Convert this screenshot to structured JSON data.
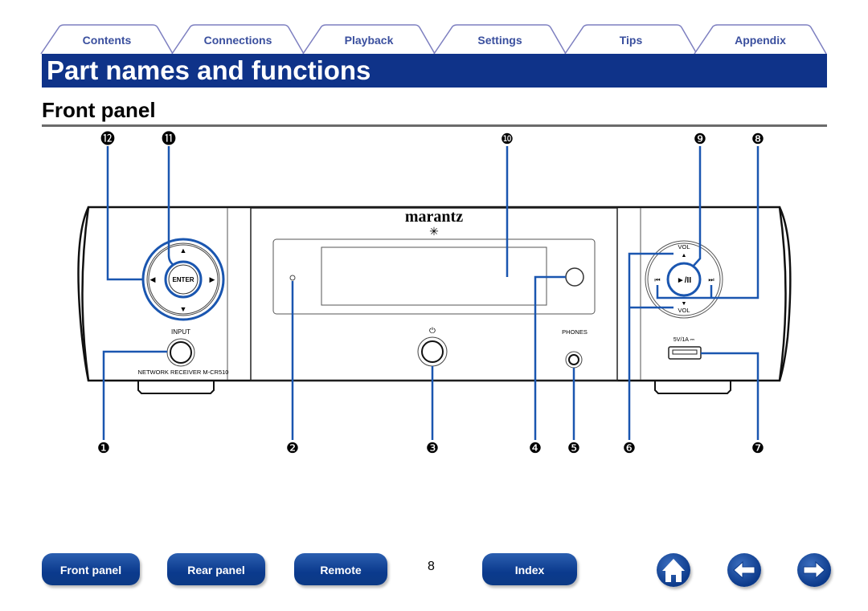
{
  "tabs": [
    {
      "label": "Contents"
    },
    {
      "label": "Connections"
    },
    {
      "label": "Playback"
    },
    {
      "label": "Settings"
    },
    {
      "label": "Tips"
    },
    {
      "label": "Appendix"
    }
  ],
  "page_title": "Part names and functions",
  "section_title": "Front panel",
  "device": {
    "brand_logo": "marantz",
    "enter_label": "ENTER",
    "input_label": "INPUT",
    "model_label": "NETWORK RECEIVER M-CR510",
    "phones_label": "PHONES",
    "vol_up_label": "VOL",
    "vol_down_label": "VOL",
    "play_pause_label": "►/II",
    "usb_label": "5V/1A ⎓"
  },
  "callouts": {
    "top": [
      "⓬",
      "⓫",
      "❿",
      "❾",
      "❽"
    ],
    "bottom": [
      "❶",
      "❷",
      "❸",
      "❹",
      "❺",
      "❻",
      "❼"
    ]
  },
  "footer": {
    "front_panel": "Front panel",
    "rear_panel": "Rear panel",
    "remote": "Remote",
    "page_number": "8",
    "index": "Index"
  },
  "colors": {
    "accent": "#0f3389",
    "callout_line": "#1a56b0",
    "tab_text": "#3a4f9e"
  }
}
